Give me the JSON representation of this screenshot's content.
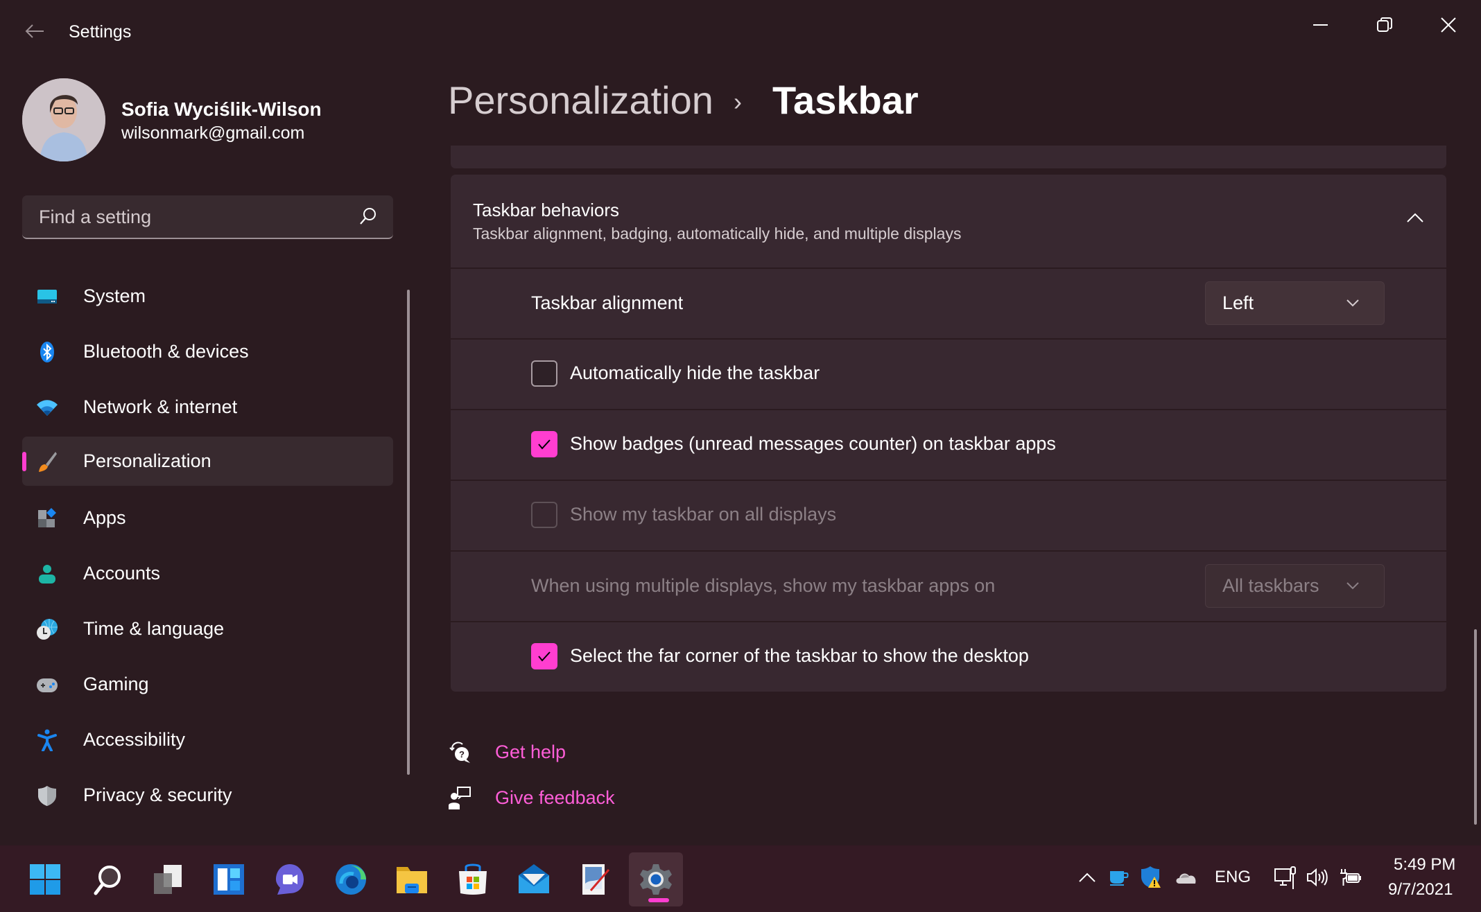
{
  "window": {
    "title": "Settings",
    "controls": {
      "minimize": "minimize",
      "maximize": "restore",
      "close": "close"
    }
  },
  "profile": {
    "name": "Sofia Wyciślik-Wilson",
    "email": "wilsonmark@gmail.com"
  },
  "search": {
    "placeholder": "Find a setting",
    "value": ""
  },
  "sidebar": {
    "items": [
      {
        "label": "System",
        "icon": "system-icon",
        "selected": false
      },
      {
        "label": "Bluetooth & devices",
        "icon": "bluetooth-icon",
        "selected": false
      },
      {
        "label": "Network & internet",
        "icon": "wifi-icon",
        "selected": false
      },
      {
        "label": "Personalization",
        "icon": "brush-icon",
        "selected": true
      },
      {
        "label": "Apps",
        "icon": "apps-icon",
        "selected": false
      },
      {
        "label": "Accounts",
        "icon": "person-icon",
        "selected": false
      },
      {
        "label": "Time & language",
        "icon": "globe-clock-icon",
        "selected": false
      },
      {
        "label": "Gaming",
        "icon": "gamepad-icon",
        "selected": false
      },
      {
        "label": "Accessibility",
        "icon": "accessibility-icon",
        "selected": false
      },
      {
        "label": "Privacy & security",
        "icon": "shield-icon",
        "selected": false
      }
    ]
  },
  "breadcrumb": {
    "parent": "Personalization",
    "separator": "›",
    "current": "Taskbar"
  },
  "section": {
    "title": "Taskbar behaviors",
    "subtitle": "Taskbar alignment, badging, automatically hide, and multiple displays",
    "expanded": true,
    "rows": [
      {
        "type": "dropdown",
        "label": "Taskbar alignment",
        "value": "Left",
        "disabled": false
      },
      {
        "type": "checkbox",
        "label": "Automatically hide the taskbar",
        "checked": false,
        "disabled": false
      },
      {
        "type": "checkbox",
        "label": "Show badges (unread messages counter) on taskbar apps",
        "checked": true,
        "disabled": false
      },
      {
        "type": "checkbox",
        "label": "Show my taskbar on all displays",
        "checked": false,
        "disabled": true
      },
      {
        "type": "dropdown",
        "label": "When using multiple displays, show my taskbar apps on",
        "value": "All taskbars",
        "disabled": true
      },
      {
        "type": "checkbox",
        "label": "Select the far corner of the taskbar to show the desktop",
        "checked": true,
        "disabled": false
      }
    ]
  },
  "links": {
    "help": "Get help",
    "feedback": "Give feedback"
  },
  "taskbar": {
    "apps": [
      {
        "name": "Start",
        "icon": "windows-start-icon",
        "active": false
      },
      {
        "name": "Search",
        "icon": "search-icon",
        "active": false
      },
      {
        "name": "Task View",
        "icon": "task-view-icon",
        "active": false
      },
      {
        "name": "Widgets",
        "icon": "widgets-icon",
        "active": false
      },
      {
        "name": "Chat",
        "icon": "teams-chat-icon",
        "active": false
      },
      {
        "name": "Microsoft Edge",
        "icon": "edge-icon",
        "active": false
      },
      {
        "name": "File Explorer",
        "icon": "folder-icon",
        "active": false
      },
      {
        "name": "Microsoft Store",
        "icon": "store-icon",
        "active": false
      },
      {
        "name": "Mail",
        "icon": "mail-icon",
        "active": false
      },
      {
        "name": "Paint",
        "icon": "paint-icon",
        "active": false
      },
      {
        "name": "Settings",
        "icon": "settings-gear-icon",
        "active": true
      }
    ],
    "tray": {
      "language": "ENG",
      "time": "5:49 PM",
      "date": "9/7/2021"
    }
  },
  "colors": {
    "accent": "#ff3ed0",
    "link": "#ff5ed8",
    "background": "#2b1b20",
    "card": "#382830",
    "taskbar": "#341a24"
  }
}
